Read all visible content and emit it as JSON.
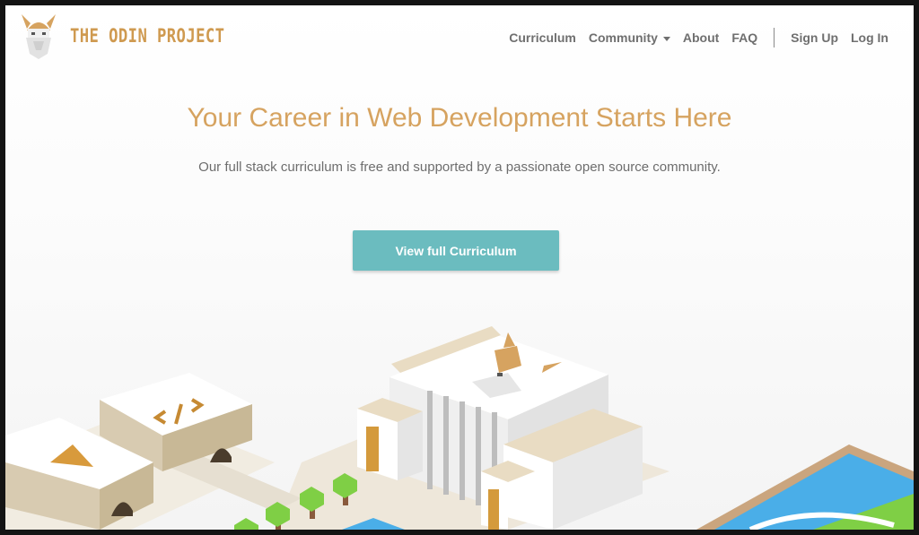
{
  "brand": {
    "name": "THE ODIN PROJECT",
    "accent_color": "#cf9a50",
    "logo_icon": "odin-viking-icon"
  },
  "nav": {
    "items": [
      {
        "label": "Curriculum"
      },
      {
        "label": "Community",
        "has_dropdown": true
      },
      {
        "label": "About"
      },
      {
        "label": "FAQ"
      }
    ],
    "sign_up": "Sign Up",
    "log_in": "Log In"
  },
  "hero": {
    "title": "Your Career in Web Development Starts Here",
    "subtitle": "Our full stack curriculum is free and supported by a passionate open source community.",
    "cta_label": "View full Curriculum",
    "cta_color": "#6bbcbf"
  },
  "illustration": {
    "icons": [
      "code-tag-icon",
      "triangle-logo-icon",
      "odin-head-icon",
      "tree-icon",
      "pool-icon"
    ]
  }
}
